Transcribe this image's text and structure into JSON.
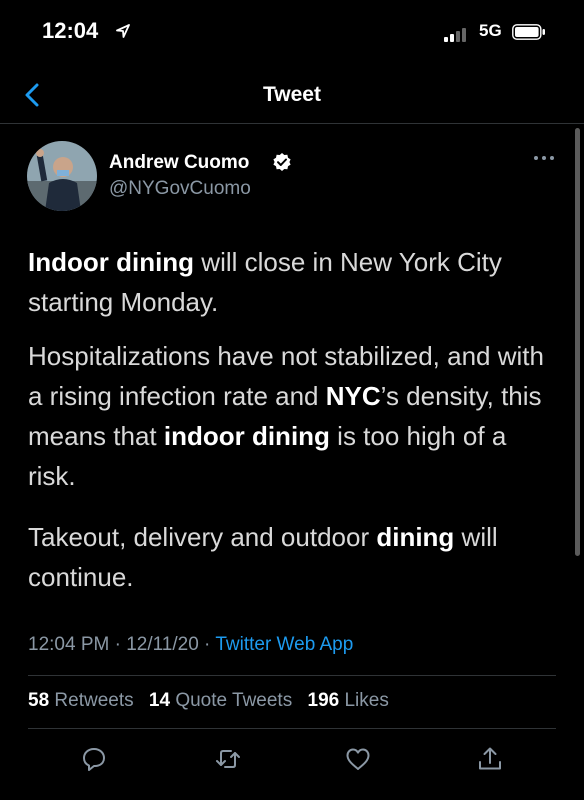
{
  "status_bar": {
    "time": "12:04",
    "network": "5G"
  },
  "header": {
    "title": "Tweet"
  },
  "author": {
    "name": "Andrew Cuomo",
    "handle": "@NYGovCuomo"
  },
  "tweet": {
    "p1": {
      "bold1": "Indoor dining",
      "rest1": " will close in New York City starting Monday."
    },
    "p2": {
      "t1": "Hospitalizations have not stabilized, and with a rising infection rate and ",
      "bold1": "NYC",
      "t2": "’s density, this means that ",
      "bold2": "indoor dining",
      "t3": " is too high of a risk."
    },
    "p3": {
      "t1": "Takeout, delivery and outdoor ",
      "bold1": "dining",
      "t2": " will continue."
    }
  },
  "meta": {
    "time": "12:04 PM",
    "sep1": " · ",
    "date": "12/11/20",
    "sep2": " · ",
    "source": "Twitter Web App"
  },
  "stats": {
    "retweets_count": "58",
    "retweets_label": "Retweets",
    "quotes_count": "14",
    "quotes_label": "Quote Tweets",
    "likes_count": "196",
    "likes_label": "Likes"
  },
  "colors": {
    "background": "#000000",
    "link": "#1d9bf0",
    "muted": "#8b98a5",
    "divider": "#2f3336"
  },
  "icons": [
    "location-icon",
    "signal-icon",
    "battery-icon",
    "back-chevron-icon",
    "verified-icon",
    "more-icon",
    "reply-icon",
    "retweet-icon",
    "like-icon",
    "share-icon"
  ]
}
